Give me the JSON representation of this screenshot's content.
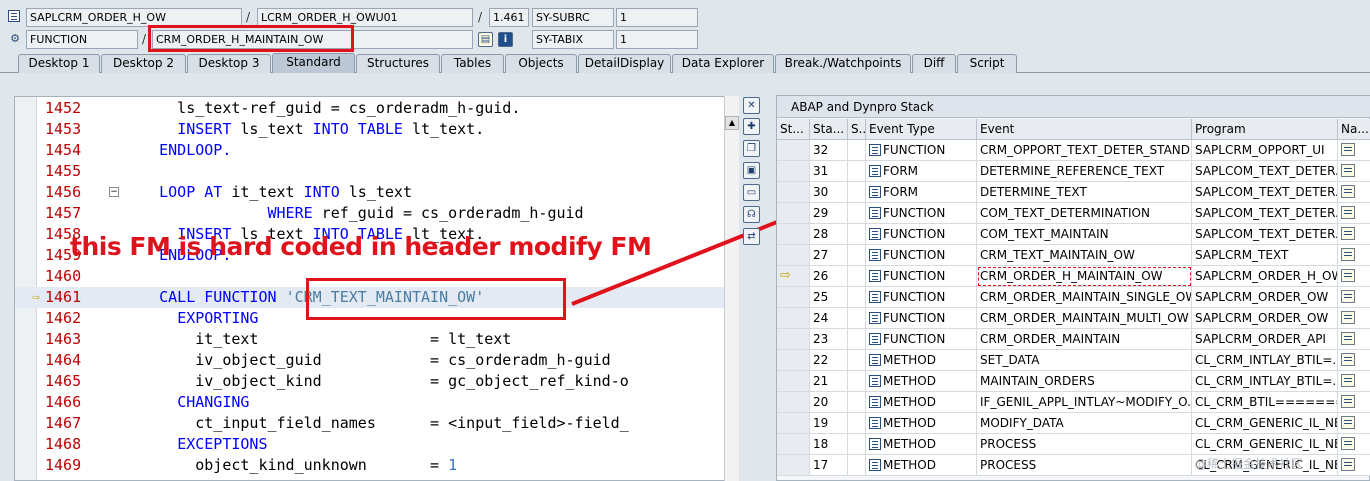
{
  "top": {
    "program": "SAPLCRM_ORDER_H_OW",
    "include": "LCRM_ORDER_H_OWU01",
    "line_no": "1.461",
    "subrc_label": "SY-SUBRC",
    "subrc_value": "1",
    "event_type": "FUNCTION",
    "event_name": "CRM_ORDER_H_MAINTAIN_OW",
    "tabix_label": "SY-TABIX",
    "tabix_value": "1",
    "sep": "/"
  },
  "tabs": [
    "Desktop 1",
    "Desktop 2",
    "Desktop 3",
    "Standard",
    "Structures",
    "Tables",
    "Objects",
    "DetailDisplay",
    "Data Explorer",
    "Break./Watchpoints",
    "Diff",
    "Script"
  ],
  "active_tab": "Standard",
  "code": [
    {
      "ln": "1452",
      "parts": [
        [
          "t",
          "      ls_text-ref_guid = cs_orderadm_h-guid."
        ]
      ]
    },
    {
      "ln": "1453",
      "parts": [
        [
          "t",
          "      "
        ],
        [
          "k",
          "INSERT"
        ],
        [
          "t",
          " ls_text "
        ],
        [
          "k",
          "INTO TABLE"
        ],
        [
          "t",
          " lt_text."
        ]
      ]
    },
    {
      "ln": "1454",
      "parts": [
        [
          "t",
          "    "
        ],
        [
          "k",
          "ENDLOOP."
        ]
      ]
    },
    {
      "ln": "1455",
      "parts": [
        [
          "t",
          ""
        ]
      ]
    },
    {
      "ln": "1456",
      "parts": [
        [
          "t",
          "    "
        ],
        [
          "k",
          "LOOP AT"
        ],
        [
          "t",
          " it_text "
        ],
        [
          "k",
          "INTO"
        ],
        [
          "t",
          " ls_text"
        ]
      ]
    },
    {
      "ln": "1457",
      "parts": [
        [
          "t",
          "                "
        ],
        [
          "k",
          "WHERE"
        ],
        [
          "t",
          " ref_guid = cs_orderadm_h-guid"
        ]
      ]
    },
    {
      "ln": "1458",
      "parts": [
        [
          "t",
          "      "
        ],
        [
          "k",
          "INSERT"
        ],
        [
          "t",
          " ls_text "
        ],
        [
          "k",
          "INTO TABLE"
        ],
        [
          "t",
          " lt_text."
        ]
      ]
    },
    {
      "ln": "1459",
      "parts": [
        [
          "t",
          "    "
        ],
        [
          "k",
          "ENDLOOP."
        ]
      ]
    },
    {
      "ln": "1460",
      "parts": [
        [
          "t",
          ""
        ]
      ]
    },
    {
      "ln": "1461",
      "parts": [
        [
          "t",
          "    "
        ],
        [
          "k",
          "CALL FUNCTION"
        ],
        [
          "t",
          " "
        ],
        [
          "s",
          "'CRM_TEXT_MAINTAIN_OW'"
        ]
      ]
    },
    {
      "ln": "1462",
      "parts": [
        [
          "t",
          "      "
        ],
        [
          "k",
          "EXPORTING"
        ]
      ]
    },
    {
      "ln": "1463",
      "parts": [
        [
          "t",
          "        it_text                   = lt_text"
        ]
      ]
    },
    {
      "ln": "1464",
      "parts": [
        [
          "t",
          "        iv_object_guid            = cs_orderadm_h-guid"
        ]
      ]
    },
    {
      "ln": "1465",
      "parts": [
        [
          "t",
          "        iv_object_kind            = gc_object_ref_kind-o"
        ]
      ]
    },
    {
      "ln": "1466",
      "parts": [
        [
          "t",
          "      "
        ],
        [
          "k",
          "CHANGING"
        ]
      ]
    },
    {
      "ln": "1467",
      "parts": [
        [
          "t",
          "        ct_input_field_names      = <input_field>-field_"
        ]
      ]
    },
    {
      "ln": "1468",
      "parts": [
        [
          "t",
          "      "
        ],
        [
          "k",
          "EXCEPTIONS"
        ]
      ]
    },
    {
      "ln": "1469",
      "parts": [
        [
          "t",
          "        object_kind_unknown       = "
        ],
        [
          "n",
          "1"
        ]
      ]
    }
  ],
  "annotation": "this FM is hard coded in header modify FM",
  "stack": {
    "title": "ABAP and Dynpro Stack",
    "headers": [
      "St...",
      "Sta...",
      "S...",
      "Event Type",
      "Event",
      "Program",
      "Na..."
    ],
    "rows": [
      {
        "level": "32",
        "type": "FUNCTION",
        "event": "CRM_OPPORT_TEXT_DETER_STAND...",
        "program": "SAPLCRM_OPPORT_UI"
      },
      {
        "level": "31",
        "type": "FORM",
        "event": "DETERMINE_REFERENCE_TEXT",
        "program": "SAPLCOM_TEXT_DETER..."
      },
      {
        "level": "30",
        "type": "FORM",
        "event": "DETERMINE_TEXT",
        "program": "SAPLCOM_TEXT_DETER..."
      },
      {
        "level": "29",
        "type": "FUNCTION",
        "event": "COM_TEXT_DETERMINATION",
        "program": "SAPLCOM_TEXT_DETER..."
      },
      {
        "level": "28",
        "type": "FUNCTION",
        "event": "COM_TEXT_MAINTAIN",
        "program": "SAPLCOM_TEXT_DETER..."
      },
      {
        "level": "27",
        "type": "FUNCTION",
        "event": "CRM_TEXT_MAINTAIN_OW",
        "program": "SAPLCRM_TEXT"
      },
      {
        "level": "26",
        "type": "FUNCTION",
        "event": "CRM_ORDER_H_MAINTAIN_OW",
        "program": "SAPLCRM_ORDER_H_OW",
        "current": true
      },
      {
        "level": "25",
        "type": "FUNCTION",
        "event": "CRM_ORDER_MAINTAIN_SINGLE_OW",
        "program": "SAPLCRM_ORDER_OW"
      },
      {
        "level": "24",
        "type": "FUNCTION",
        "event": "CRM_ORDER_MAINTAIN_MULTI_OW",
        "program": "SAPLCRM_ORDER_OW"
      },
      {
        "level": "23",
        "type": "FUNCTION",
        "event": "CRM_ORDER_MAINTAIN",
        "program": "SAPLCRM_ORDER_API"
      },
      {
        "level": "22",
        "type": "METHOD",
        "event": "SET_DATA",
        "program": "CL_CRM_INTLAY_BTIL=..."
      },
      {
        "level": "21",
        "type": "METHOD",
        "event": "MAINTAIN_ORDERS",
        "program": "CL_CRM_INTLAY_BTIL=..."
      },
      {
        "level": "20",
        "type": "METHOD",
        "event": "IF_GENIL_APPL_INTLAY~MODIFY_O...",
        "program": "CL_CRM_BTIL========..."
      },
      {
        "level": "19",
        "type": "METHOD",
        "event": "MODIFY_DATA",
        "program": "CL_CRM_GENERIC_IL_NE..."
      },
      {
        "level": "18",
        "type": "METHOD",
        "event": "PROCESS",
        "program": "CL_CRM_GENERIC_IL_NE..."
      },
      {
        "level": "17",
        "type": "METHOD",
        "event": "PROCESS",
        "program": "CL_CRM_GENERIC_IL_NE..."
      }
    ]
  },
  "watermark": "@稀土掘金技术社区",
  "colors": {
    "annotation_red": "#e0121b",
    "keyword_blue": "#0000ff",
    "line_number_red": "#c00000"
  }
}
